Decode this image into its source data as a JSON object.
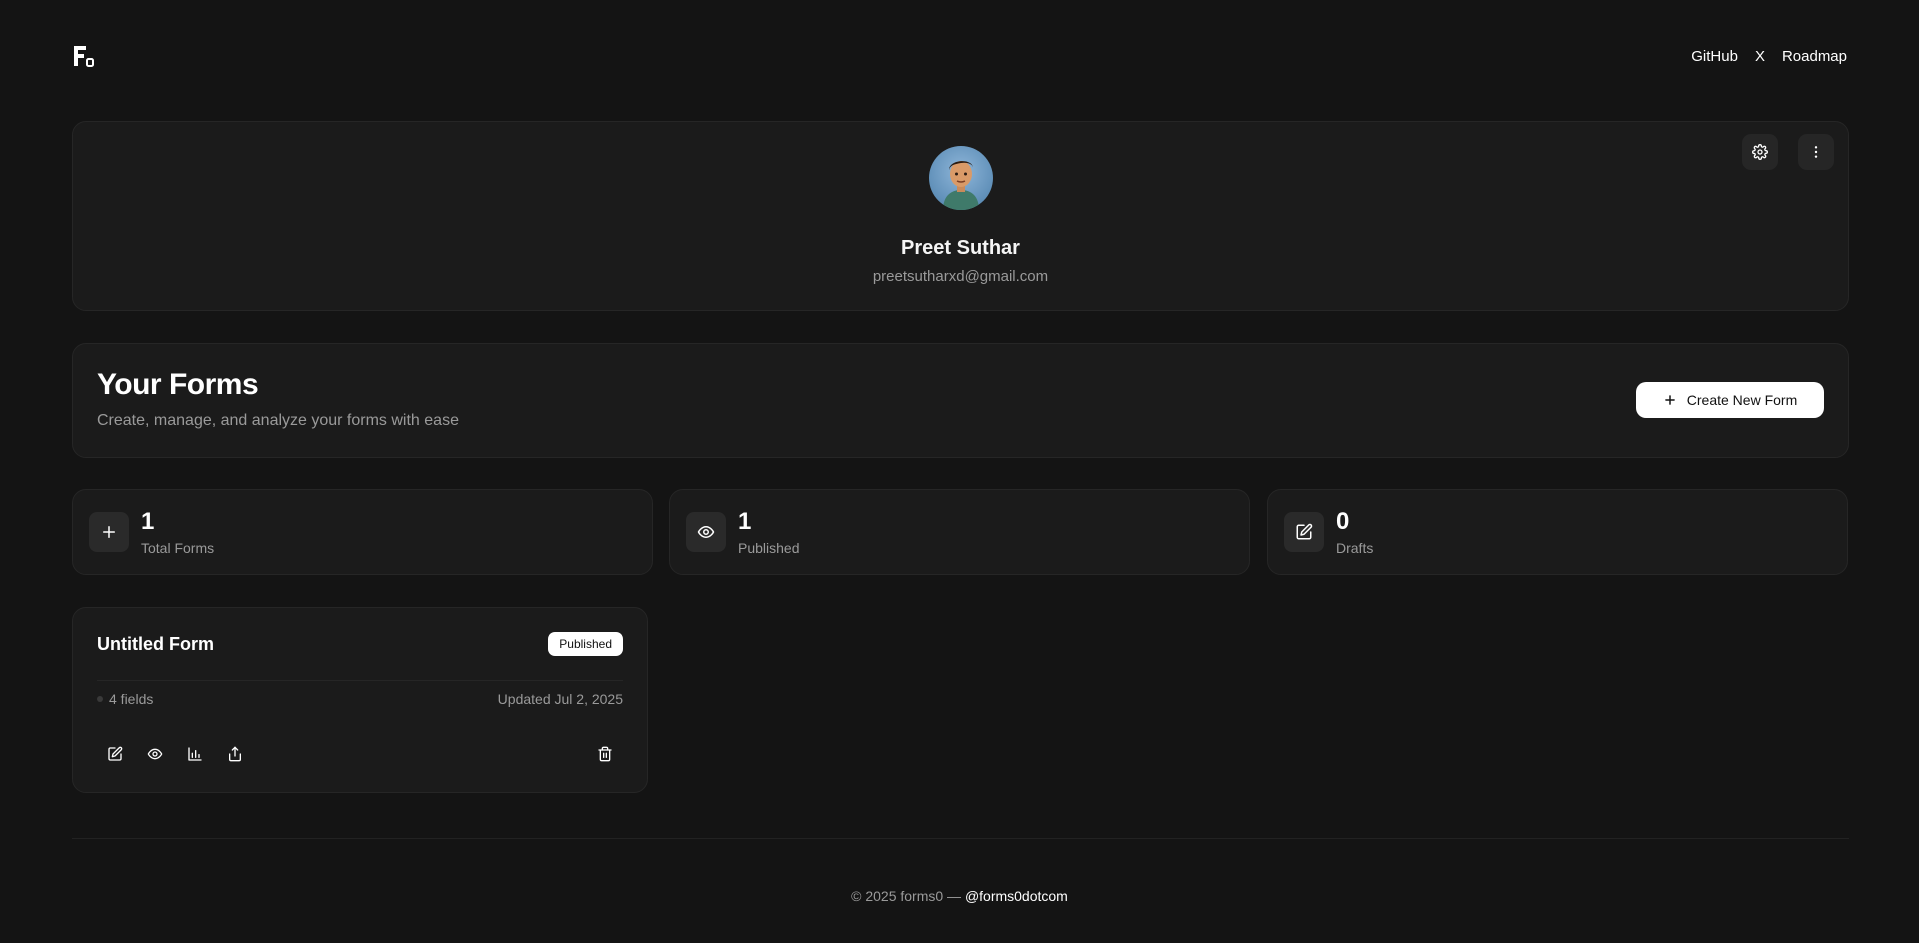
{
  "header": {
    "logo_icon": "forms0-logo-icon",
    "nav": [
      "GitHub",
      "X",
      "Roadmap"
    ]
  },
  "profile": {
    "name": "Preet Suthar",
    "email": "preetsutharxd@gmail.com",
    "settings_icon": "gear-icon",
    "more_icon": "more-vertical-icon"
  },
  "forms_header": {
    "title": "Your Forms",
    "subtitle": "Create, manage, and analyze your forms with ease",
    "create_label": "Create New Form"
  },
  "stats": [
    {
      "value": "1",
      "label": "Total Forms",
      "icon": "plus-icon"
    },
    {
      "value": "1",
      "label": "Published",
      "icon": "eye-icon"
    },
    {
      "value": "0",
      "label": "Drafts",
      "icon": "edit-icon"
    }
  ],
  "forms": [
    {
      "title": "Untitled Form",
      "status": "Published",
      "fields": "4 fields",
      "updated": "Updated Jul 2, 2025"
    }
  ],
  "footer": {
    "copyright": "© 2025 forms0 — ",
    "handle": "@forms0dotcom"
  },
  "colors": {
    "background": "#141414",
    "card": "#1b1b1b",
    "border": "#262626",
    "muted_text": "#9a9a9a",
    "primary_button": "#ffffff"
  }
}
